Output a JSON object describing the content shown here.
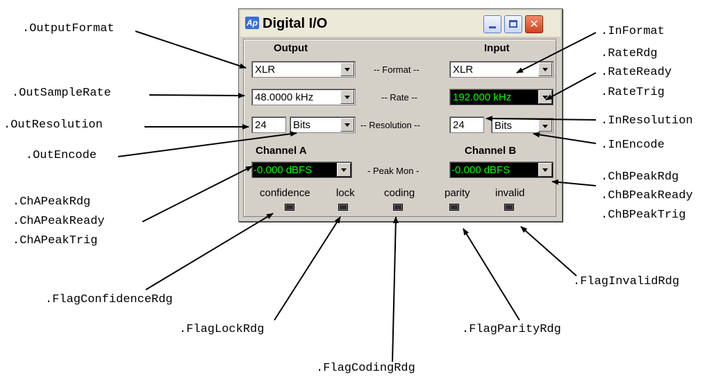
{
  "window": {
    "app_icon": "Ap",
    "title": "Digital I/O",
    "controls": {
      "minimize": "minimize-icon",
      "maximize": "maximize-icon",
      "close": "✕"
    }
  },
  "headers": {
    "output": "Output",
    "input": "Input",
    "channel_a": "Channel A",
    "channel_b": "Channel B"
  },
  "rows": {
    "format_label": "-- Format --",
    "rate_label": "-- Rate --",
    "resolution_label": "-- Resolution --",
    "peak_label": "- Peak Mon -"
  },
  "output": {
    "format": "XLR",
    "sample_rate": "48.0000 kHz",
    "resolution": "24",
    "encode": "Bits"
  },
  "input": {
    "format": "XLR",
    "rate_reading": "192.000 kHz",
    "resolution": "24",
    "encode": "Bits"
  },
  "peak": {
    "channel_a": "-0.000  dBFS",
    "channel_b": "-0.000  dBFS"
  },
  "flags": [
    {
      "label": "confidence"
    },
    {
      "label": "lock"
    },
    {
      "label": "coding"
    },
    {
      "label": "parity"
    },
    {
      "label": "invalid"
    }
  ],
  "annotations": {
    "output_format": ".OutputFormat",
    "out_sample_rate": ".OutSampleRate",
    "out_resolution": ".OutResolution",
    "out_encode": ".OutEncode",
    "ch_a_peak_rdg": ".ChAPeakRdg",
    "ch_a_peak_ready": ".ChAPeakReady",
    "ch_a_peak_trig": ".ChAPeakTrig",
    "in_format": ".InFormat",
    "rate_rdg": ".RateRdg",
    "rate_ready": ".RateReady",
    "rate_trig": ".RateTrig",
    "in_resolution": ".InResolution",
    "in_encode": ".InEncode",
    "ch_b_peak_rdg": ".ChBPeakRdg",
    "ch_b_peak_ready": ".ChBPeakReady",
    "ch_b_peak_trig": ".ChBPeakTrig",
    "flag_confidence_rdg": ".FlagConfidenceRdg",
    "flag_lock_rdg": ".FlagLockRdg",
    "flag_coding_rdg": ".FlagCodingRdg",
    "flag_parity_rdg": ".FlagParityRdg",
    "flag_invalid_rdg": ".FlagInvalidRdg"
  }
}
